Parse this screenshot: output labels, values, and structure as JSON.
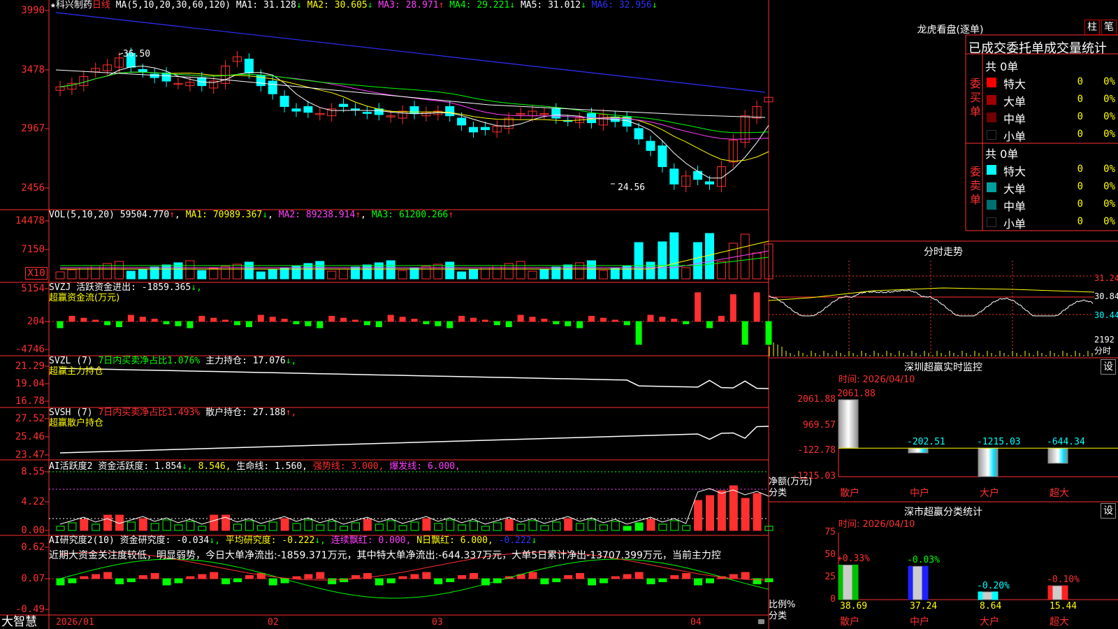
{
  "app": {
    "brand": "大智慧",
    "lock_icon": "lock-icon"
  },
  "kline": {
    "title_star": "★",
    "stock": "科兴制药",
    "period": "日线",
    "ma_header": "MA(5,10,20,30,60,120)",
    "ma": [
      {
        "label": "MA1:",
        "value": "31.128",
        "arrow": "↓",
        "color": "#ffffff"
      },
      {
        "label": "MA2:",
        "value": "30.605",
        "arrow": "↓",
        "color": "#ffff00"
      },
      {
        "label": "MA3:",
        "value": "28.971",
        "arrow": "↑",
        "color": "#ff40ff"
      },
      {
        "label": "MA4:",
        "value": "29.221",
        "arrow": "↓",
        "color": "#00ff00"
      },
      {
        "label": "MA5:",
        "value": "31.012",
        "arrow": "↓",
        "color": "#ffffff"
      },
      {
        "label": "MA6:",
        "value": "32.956",
        "arrow": "↓",
        "color": "#3030ff"
      }
    ],
    "yticks": [
      "3990",
      "3478",
      "2967",
      "2456"
    ],
    "high_label": "36.50",
    "low_label": "24.56"
  },
  "vol": {
    "header": "VOL(5,10,20)",
    "value": "59504.770",
    "value_arrow": "↑",
    "ma1": "MA1: 70989.367",
    "ma1_arrow": "↓",
    "ma2": "MA2: 89238.914",
    "ma2_arrow": "↑",
    "ma3": "MA3: 61200.266",
    "ma3_arrow": "↑",
    "yticks": [
      "14478",
      "7150"
    ],
    "unit": "X10"
  },
  "svzj": {
    "header": "SVZJ",
    "label": "活跃资金进出:",
    "value": "-1859.365",
    "arrow": "↓,",
    "subtitle": "超赢资金流(万元)",
    "yticks": [
      "5154",
      "204",
      "-4746"
    ]
  },
  "svzl": {
    "header": "SVZL (7)",
    "ratio": "7日内买卖净占比1.076%",
    "label": "主力持仓:",
    "value": "17.076",
    "arrow": "↓,",
    "subtitle": "超赢主力持仓",
    "yticks": [
      "21.29",
      "19.04",
      "16.78"
    ]
  },
  "svsh": {
    "header": "SVSH (7)",
    "ratio": "7日内买卖净占比1.493%",
    "label": "散户持仓:",
    "value": "27.188",
    "arrow": "↑,",
    "subtitle": "超赢散户持仓",
    "yticks": [
      "27.52",
      "25.46",
      "23.47"
    ]
  },
  "ai1": {
    "header": "AI活跃度2",
    "label": "资金活跃度:",
    "value": "1.854",
    "arrow": "↓,",
    "v2": "8.546,",
    "life": "生命线: 1.560,",
    "strong": "强势线: 3.000,",
    "burst": "爆发线: 6.000,",
    "yticks": [
      "8.55",
      "4.22",
      "0.00"
    ]
  },
  "ai2": {
    "header": "AI研究度2(10)",
    "label": "资金研究度:",
    "value": "-0.034",
    "arrow": "↓,",
    "avg": "平均研究度: -0.222",
    "avg_arrow": "↓,",
    "cont": "连续飘红: 0.000,",
    "nday": "N日飘红: 6.000,",
    "last": "-0.222",
    "last_arrow": "↓",
    "comment": "近期大资金关注度较低，明显弱势，今日大单净流出:-1859.371万元，其中特大单净流出:-644.337万元，大单5日累计净出-13707.399万元，当前主力控",
    "yticks": [
      "0.62",
      "0.07",
      "-0.49"
    ]
  },
  "xaxis": [
    "2026/01",
    "02",
    "03",
    "04"
  ],
  "lhb": {
    "title": "龙虎看盘(逐单)",
    "btn_bar": "柱",
    "btn_pen": "笔",
    "subtitle": "已成交委托单成交量统计",
    "buy": {
      "side": "委买单",
      "total": "共 0单",
      "rows": [
        {
          "name": "特大",
          "v": "0",
          "p": "0%",
          "c": "#ff0000"
        },
        {
          "name": "大单",
          "v": "0",
          "p": "0%",
          "c": "#a00000"
        },
        {
          "name": "中单",
          "v": "0",
          "p": "0%",
          "c": "#700000"
        },
        {
          "name": "小单",
          "v": "0",
          "p": "0%",
          "c": "#000000"
        }
      ]
    },
    "sell": {
      "side": "委卖单",
      "total": "共 0单",
      "rows": [
        {
          "name": "特大",
          "v": "0",
          "p": "0%",
          "c": "#00ffff"
        },
        {
          "name": "大单",
          "v": "0",
          "p": "0%",
          "c": "#00a0a0"
        },
        {
          "name": "中单",
          "v": "0",
          "p": "0%",
          "c": "#007070"
        },
        {
          "name": "小单",
          "v": "0",
          "p": "0%",
          "c": "#000000"
        }
      ]
    }
  },
  "intraday": {
    "title": "分时走势",
    "prices": [
      "31.24",
      "30.84",
      "30.44"
    ],
    "vol": "2192",
    "period": "分时"
  },
  "sz_monitor": {
    "title": "深圳超赢实时监控",
    "btn": "设",
    "time": "时间: 2026/04/10",
    "yticks": [
      "2061.88",
      "969.57",
      "-122.78",
      "-1215.03"
    ],
    "ylabel": "净额(万元)",
    "xlabel": "分类",
    "cats": [
      "散户",
      "中户",
      "大户",
      "超大"
    ],
    "values": [
      "2061.88",
      "-202.51",
      "-1215.03",
      "-644.34"
    ]
  },
  "sz_class": {
    "title": "深市超赢分类统计",
    "btn": "设",
    "time": "时间: 2026/04/10",
    "yticks": [
      "75",
      "50",
      "25",
      "0"
    ],
    "ylabel": "比例%",
    "xlabel": "分类",
    "cats": [
      "散户",
      "中户",
      "大户",
      "超大"
    ],
    "changes": [
      "+0.33%",
      "-0.03%",
      "-0.20%",
      "-0.10%"
    ],
    "values": [
      "38.69",
      "37.24",
      "8.64",
      "15.44"
    ]
  },
  "chart_data": [
    {
      "type": "bar",
      "title": "深圳超赢实时监控",
      "categories": [
        "散户",
        "中户",
        "大户",
        "超大"
      ],
      "values": [
        2061.88,
        -202.51,
        -1215.03,
        -644.34
      ],
      "ylabel": "净额(万元)",
      "xlabel": "分类",
      "ylim": [
        -1215.03,
        2061.88
      ]
    },
    {
      "type": "bar",
      "title": "深市超赢分类统计",
      "categories": [
        "散户",
        "中户",
        "大户",
        "超大"
      ],
      "values": [
        38.69,
        37.24,
        8.64,
        15.44
      ],
      "ylabel": "比例%",
      "xlabel": "分类",
      "ylim": [
        0,
        75
      ]
    }
  ]
}
